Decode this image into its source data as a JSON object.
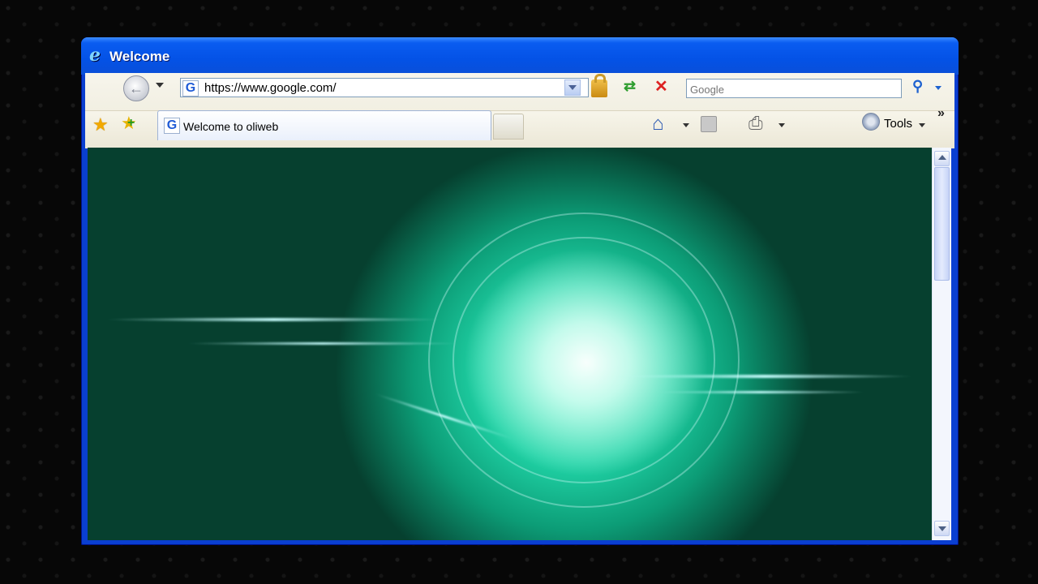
{
  "window": {
    "title": "Welcome"
  },
  "address_bar": {
    "url": "https://www.google.com/"
  },
  "search": {
    "placeholder": "Google"
  },
  "tab": {
    "label": "Welcome to oliweb"
  },
  "toolbar": {
    "tools_label": "Tools"
  },
  "icons": {
    "browser": "internet-explorer-icon",
    "back": "back-icon",
    "favorites": "star-icon",
    "add_favorite": "add-favorite-icon",
    "home": "home-icon",
    "feeds": "feed-icon",
    "print": "print-icon",
    "tools": "tools-icon",
    "lock": "lock-icon",
    "refresh": "refresh-icon",
    "stop": "stop-icon",
    "search": "search-icon"
  },
  "colors": {
    "titlebar": "#0a5cf0",
    "glow": "#2ad8aa",
    "background": "#070707"
  }
}
